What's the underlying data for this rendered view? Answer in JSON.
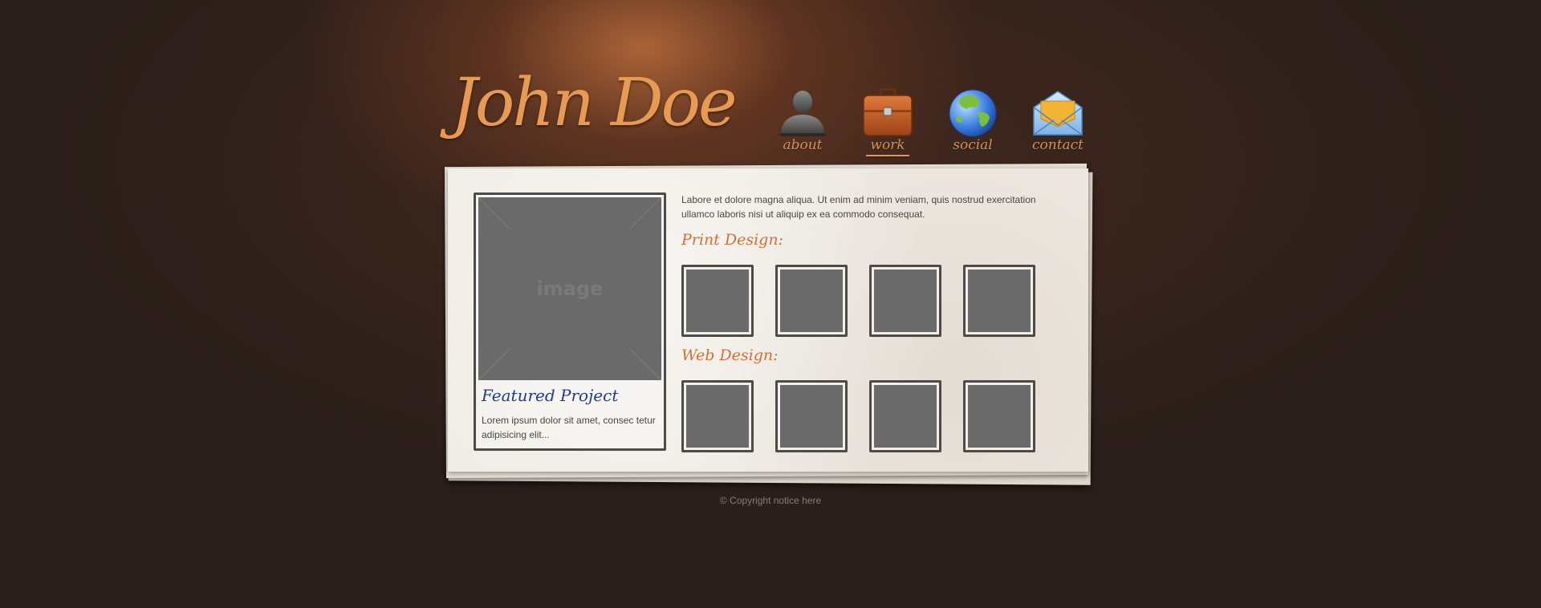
{
  "header": {
    "logo_text": "John Doe"
  },
  "nav": {
    "items": [
      {
        "label": "about",
        "icon": "user-icon"
      },
      {
        "label": "work",
        "icon": "briefcase-icon",
        "active": true
      },
      {
        "label": "social",
        "icon": "globe-icon"
      },
      {
        "label": "contact",
        "icon": "envelope-icon"
      }
    ]
  },
  "featured": {
    "image_placeholder": "image",
    "title": "Featured Project",
    "text": "Lorem ipsum dolor sit amet, consec tetur adipisicing elit..."
  },
  "intro_text": "Labore et dolore magna aliqua. Ut enim ad minim veniam, quis nostrud exercitation ullamco laboris nisi ut aliquip ex ea commodo consequat.",
  "sections": {
    "print": {
      "title": "Print Design:",
      "thumb_count": 4
    },
    "web": {
      "title": "Web Design:",
      "thumb_count": 4
    }
  },
  "footer": {
    "copyright": "© Copyright notice here"
  },
  "colors": {
    "background": "#2b1f1b",
    "logo": "#e99a52",
    "nav_label": "#d99252",
    "paper": "#efebe4",
    "section_title": "#d0703a",
    "featured_title": "#1f3b8a",
    "placeholder": "#6a6a6a"
  }
}
